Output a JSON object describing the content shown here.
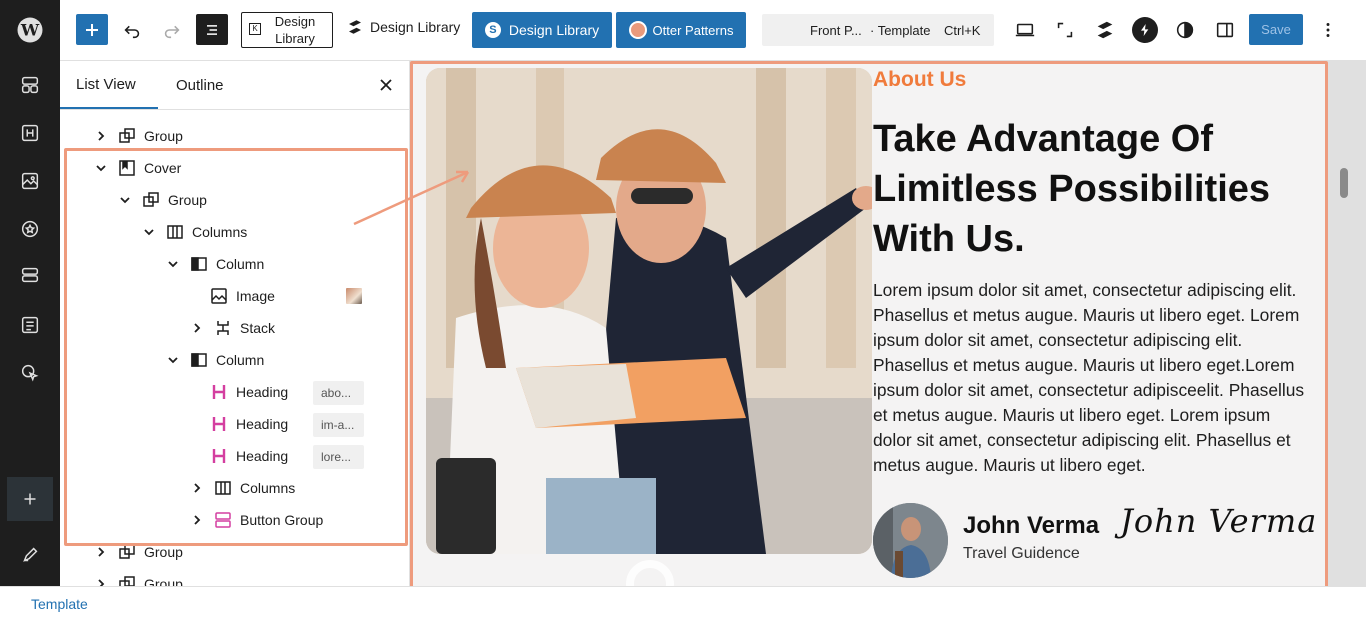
{
  "sidebar": {
    "items": [
      {
        "name": "wordpress-logo-icon"
      },
      {
        "name": "layout-icon"
      },
      {
        "name": "heading-icon"
      },
      {
        "name": "image-icon"
      },
      {
        "name": "badge-icon"
      },
      {
        "name": "stack-icon"
      },
      {
        "name": "document-icon"
      },
      {
        "name": "cursor-icon"
      },
      {
        "name": "add-icon"
      },
      {
        "name": "edit-icon"
      }
    ]
  },
  "toolbar": {
    "design_library_outline": "Design Library",
    "design_library_text": "Design Library",
    "design_library_button": "Design Library",
    "otter_patterns": "Otter Patterns",
    "command_title": "Front P...",
    "command_type": "· Template",
    "command_shortcut": "Ctrl+K",
    "save": "Save"
  },
  "panel": {
    "tab_list": "List View",
    "tab_outline": "Outline",
    "rows": [
      {
        "label": "Group"
      },
      {
        "label": "Cover"
      },
      {
        "label": "Group"
      },
      {
        "label": "Columns"
      },
      {
        "label": "Column"
      },
      {
        "label": "Image"
      },
      {
        "label": "Stack"
      },
      {
        "label": "Column"
      },
      {
        "label": "Heading",
        "badge": "abo..."
      },
      {
        "label": "Heading",
        "badge": "im-a..."
      },
      {
        "label": "Heading",
        "badge": "lore..."
      },
      {
        "label": "Columns"
      },
      {
        "label": "Button Group"
      },
      {
        "label": "Group"
      },
      {
        "label": "Group"
      }
    ]
  },
  "content": {
    "kicker": "About Us",
    "title": "Take Advantage Of Limitless Possibilities With Us.",
    "body": "Lorem ipsum dolor sit amet, consectetur adipiscing elit. Phasellus et metus augue. Mauris ut libero eget. Lorem ipsum dolor sit amet, consectetur adipiscing elit. Phasellus et metus augue. Mauris ut libero eget.Lorem ipsum dolor sit amet, consectetur adipisceelit. Phasellus et metus augue. Mauris ut libero eget. Lorem ipsum dolor sit amet, consectetur adipiscing elit. Phasellus et metus augue. Mauris ut libero eget.",
    "person_name": "John Verma",
    "person_role": "Travel Guidence",
    "signature": "John Verma"
  },
  "footer": {
    "link": "Template"
  },
  "colors": {
    "accent": "#2271b1",
    "highlight": "#ee9b7d",
    "kicker": "#f07b3c"
  }
}
